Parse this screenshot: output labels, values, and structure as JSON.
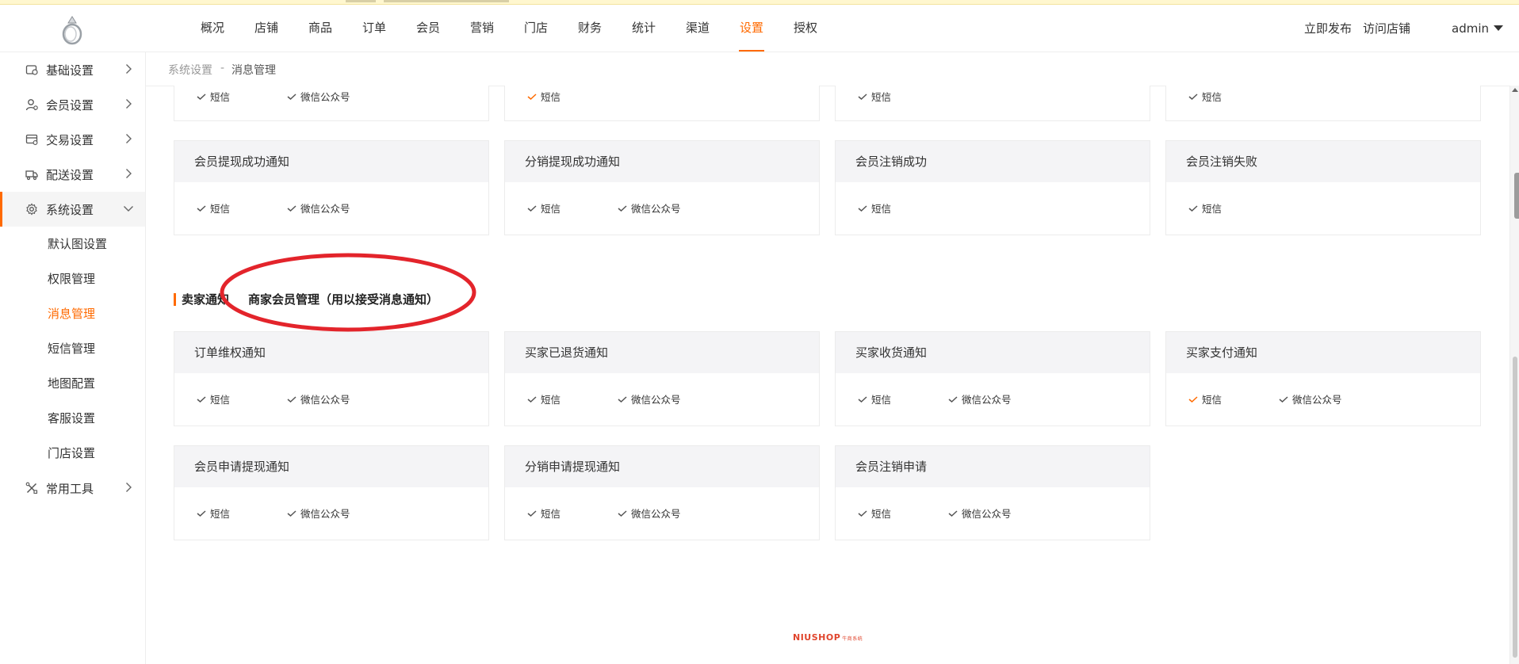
{
  "nav": [
    "概况",
    "店铺",
    "商品",
    "订单",
    "会员",
    "营销",
    "门店",
    "财务",
    "统计",
    "渠道",
    "设置",
    "授权"
  ],
  "nav_active_index": 10,
  "header_right": {
    "publish": "立即发布",
    "visit": "访问店铺",
    "admin": "admin"
  },
  "sidebar": {
    "items": [
      {
        "label": "基础设置",
        "icon": "store-settings-icon"
      },
      {
        "label": "会员设置",
        "icon": "member-icon"
      },
      {
        "label": "交易设置",
        "icon": "trade-icon"
      },
      {
        "label": "配送设置",
        "icon": "truck-icon"
      },
      {
        "label": "系统设置",
        "icon": "gear-icon"
      }
    ],
    "sub": [
      "默认图设置",
      "权限管理",
      "消息管理",
      "短信管理",
      "地图配置",
      "客服设置",
      "门店设置"
    ],
    "sub_active_index": 2,
    "tools": {
      "label": "常用工具",
      "icon": "tools-icon"
    }
  },
  "breadcrumb": {
    "parent": "系统设置",
    "sep": "-",
    "current": "消息管理"
  },
  "top_partial_rows": [
    {
      "options": [
        {
          "label": "短信",
          "checked": false
        },
        {
          "label": "微信公众号",
          "checked": false
        }
      ]
    },
    {
      "options": [
        {
          "label": "短信",
          "checked": true
        }
      ]
    },
    {
      "options": [
        {
          "label": "短信",
          "checked": false
        }
      ]
    },
    {
      "options": [
        {
          "label": "短信",
          "checked": false
        }
      ]
    }
  ],
  "buyer_cards": [
    {
      "title": "会员提现成功通知",
      "options": [
        {
          "label": "短信",
          "checked": false
        },
        {
          "label": "微信公众号",
          "checked": false
        }
      ]
    },
    {
      "title": "分销提现成功通知",
      "options": [
        {
          "label": "短信",
          "checked": false
        },
        {
          "label": "微信公众号",
          "checked": false
        }
      ]
    },
    {
      "title": "会员注销成功",
      "options": [
        {
          "label": "短信",
          "checked": false
        }
      ]
    },
    {
      "title": "会员注销失败",
      "options": [
        {
          "label": "短信",
          "checked": false
        }
      ]
    }
  ],
  "seller_section": {
    "title": "卖家通知",
    "manage_link": "商家会员管理（用以接受消息通知）",
    "cards": [
      {
        "title": "订单维权通知",
        "options": [
          {
            "label": "短信",
            "checked": false
          },
          {
            "label": "微信公众号",
            "checked": false
          }
        ]
      },
      {
        "title": "买家已退货通知",
        "options": [
          {
            "label": "短信",
            "checked": false
          },
          {
            "label": "微信公众号",
            "checked": false
          }
        ]
      },
      {
        "title": "买家收货通知",
        "options": [
          {
            "label": "短信",
            "checked": false
          },
          {
            "label": "微信公众号",
            "checked": false
          }
        ]
      },
      {
        "title": "买家支付通知",
        "options": [
          {
            "label": "短信",
            "checked": true
          },
          {
            "label": "微信公众号",
            "checked": false
          }
        ]
      },
      {
        "title": "会员申请提现通知",
        "options": [
          {
            "label": "短信",
            "checked": false
          },
          {
            "label": "微信公众号",
            "checked": false
          }
        ]
      },
      {
        "title": "分销申请提现通知",
        "options": [
          {
            "label": "短信",
            "checked": false
          },
          {
            "label": "微信公众号",
            "checked": false
          }
        ]
      },
      {
        "title": "会员注销申请",
        "options": [
          {
            "label": "短信",
            "checked": false
          },
          {
            "label": "微信公众号",
            "checked": false
          }
        ]
      }
    ]
  },
  "footer": {
    "brand": "NIUSHOP",
    "tagline": "牛商系统"
  },
  "colors": {
    "accent": "#ff6a00",
    "check": "#555555",
    "circle": "#e3242b"
  }
}
